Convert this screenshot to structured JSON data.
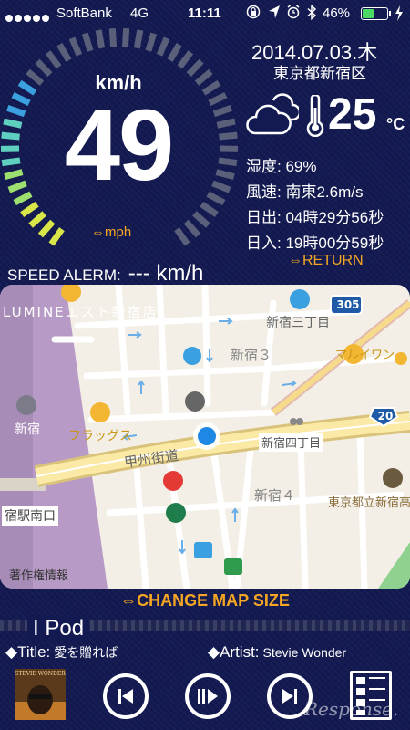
{
  "status_bar": {
    "carrier": "SoftBank",
    "network": "4G",
    "time": "11:11",
    "battery": "46%",
    "battery_level": 0.46
  },
  "speedometer": {
    "unit": "km/h",
    "value": "49",
    "mph_toggle": "⇔mph",
    "alert_label": "SPEED ALERM:",
    "alert_value": "--- km/h"
  },
  "info": {
    "date": "2014.07.03.木",
    "location": "東京都新宿区",
    "temperature": "25",
    "temp_unit": "°C",
    "humidity_label": "湿度:",
    "humidity": "69%",
    "wind_label": "風速:",
    "wind": "南東2.6m/s",
    "sunrise_label": "日出:",
    "sunrise": "04時29分56秒",
    "sunset_label": "日入:",
    "sunset": "19時00分59秒",
    "return_label": "⇔RETURN"
  },
  "map": {
    "labels": {
      "lumine": "LUMINEエスト新宿店",
      "shinjuku3": "新宿３",
      "shinjuku_sanchome": "新宿三丁目",
      "marui": "マルイワン",
      "shinjuku_station": "新宿",
      "flags": "フラッグス",
      "koshu_kaido": "甲州街道",
      "shinjuku_yonchome": "新宿四丁目",
      "shinjuku4": "新宿４",
      "school": "東京都立新宿高",
      "south_exit": "宿駅南口",
      "copyright": "著作権情報",
      "route305": "305",
      "route20": "20"
    }
  },
  "change_map_label": "⇔CHANGE MAP SIZE",
  "ipod": {
    "title": "I Pod",
    "song_label": "◆Title:",
    "song": "愛を贈れば",
    "artist_label": "◆Artist:",
    "artist": "Stevie Wonder",
    "album_text": "STEVIE WONDER"
  },
  "watermark": "Response.",
  "colors": {
    "background": "#131a52",
    "accent": "#f5a623",
    "location_dot": "#1e88e5",
    "map_green": "#8fd18f"
  }
}
